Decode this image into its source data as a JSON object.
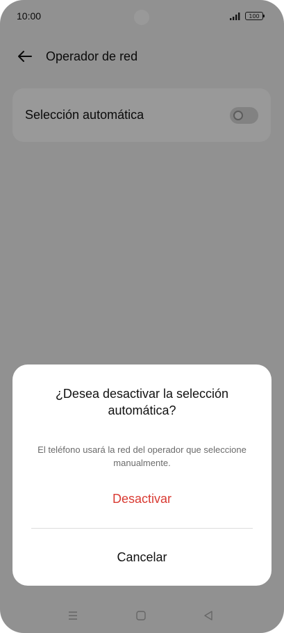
{
  "status_bar": {
    "time": "10:00",
    "battery": "100",
    "icons": [
      "signal-icon",
      "battery-icon"
    ]
  },
  "header": {
    "title": "Operador de red",
    "back_icon": "arrow-left-icon"
  },
  "settings": {
    "auto_select_label": "Selección automática",
    "auto_select_on": false
  },
  "dialog": {
    "title": "¿Desea desactivar la selección automática?",
    "message": "El teléfono usará la red del operador que seleccione manualmente.",
    "confirm_label": "Desactivar",
    "cancel_label": "Cancelar"
  },
  "nav": {
    "icons": [
      "menu-icon",
      "home-icon",
      "back-triangle-icon"
    ]
  },
  "colors": {
    "destructive": "#d93a32",
    "text_primary": "#111111",
    "text_secondary": "#6b6b6b",
    "scrim": "rgba(0,0,0,0.40)"
  }
}
